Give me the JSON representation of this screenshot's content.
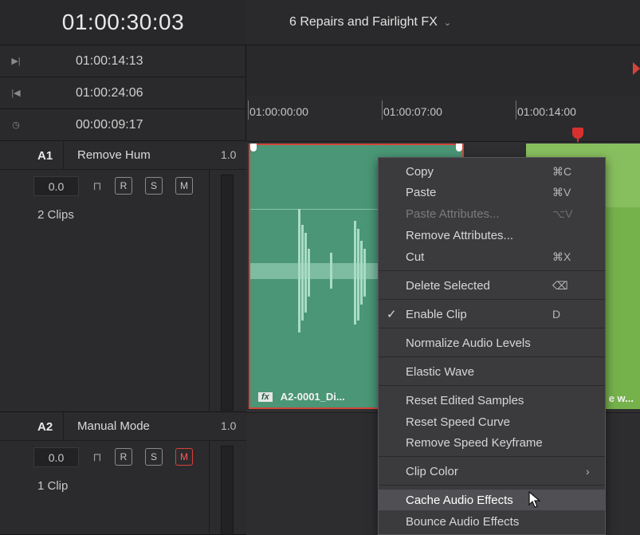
{
  "header": {
    "main_timecode": "01:00:30:03",
    "timeline_name": "6 Repairs and Fairlight FX",
    "timeline_chevron": "⌄"
  },
  "timecodes": [
    {
      "icon": "mark-in-icon",
      "glyph": "▶|",
      "value": "01:00:14:13"
    },
    {
      "icon": "mark-out-icon",
      "glyph": "|◀",
      "value": "01:00:24:06"
    },
    {
      "icon": "duration-clock-icon",
      "glyph": "◷",
      "value": "00:00:09:17"
    }
  ],
  "ruler": {
    "ticks": [
      "01:00:00:00",
      "01:00:07:00",
      "01:00:14:00"
    ]
  },
  "tracks": [
    {
      "id": "A1",
      "name": "Remove Hum",
      "volume": "1.0",
      "level": "0.0",
      "r": "R",
      "s": "S",
      "m": "M",
      "mute_active": false,
      "clip_count": "2 Clips"
    },
    {
      "id": "A2",
      "name": "Manual Mode",
      "volume": "1.0",
      "level": "0.0",
      "r": "R",
      "s": "S",
      "m": "M",
      "mute_active": true,
      "clip_count": "1 Clip"
    }
  ],
  "clips": {
    "a1_clip_label": "A2-0001_Di...",
    "a1_fx_badge": "fx",
    "b_clip_label": "e w..."
  },
  "context_menu": {
    "items": [
      {
        "label": "Copy",
        "shortcut": "⌘C",
        "state": "enabled"
      },
      {
        "label": "Paste",
        "shortcut": "⌘V",
        "state": "enabled"
      },
      {
        "label": "Paste Attributes...",
        "shortcut": "⌥V",
        "state": "disabled"
      },
      {
        "label": "Remove Attributes...",
        "shortcut": "",
        "state": "enabled"
      },
      {
        "label": "Cut",
        "shortcut": "⌘X",
        "state": "enabled"
      },
      {
        "label": "Delete Selected",
        "shortcut": "⌫",
        "state": "enabled"
      },
      {
        "label": "Enable Clip",
        "shortcut": "D",
        "state": "checked"
      },
      {
        "label": "Normalize Audio Levels",
        "shortcut": "",
        "state": "enabled"
      },
      {
        "label": "Elastic Wave",
        "shortcut": "",
        "state": "enabled"
      },
      {
        "label": "Reset Edited Samples",
        "shortcut": "",
        "state": "enabled"
      },
      {
        "label": "Reset Speed Curve",
        "shortcut": "",
        "state": "enabled"
      },
      {
        "label": "Remove Speed Keyframe",
        "shortcut": "",
        "state": "enabled"
      },
      {
        "label": "Clip Color",
        "shortcut": "",
        "state": "submenu",
        "arrow": "›"
      },
      {
        "label": "Cache Audio Effects",
        "shortcut": "",
        "state": "hover"
      },
      {
        "label": "Bounce Audio Effects",
        "shortcut": "",
        "state": "enabled"
      }
    ],
    "check_glyph": "✓"
  },
  "colors": {
    "clip_selected_border": "#d2463b",
    "clip_a_fill": "#4a9676",
    "clip_b_fill": "#76b24b",
    "playhead": "#d8312d",
    "mute_active": "#d9403a"
  }
}
